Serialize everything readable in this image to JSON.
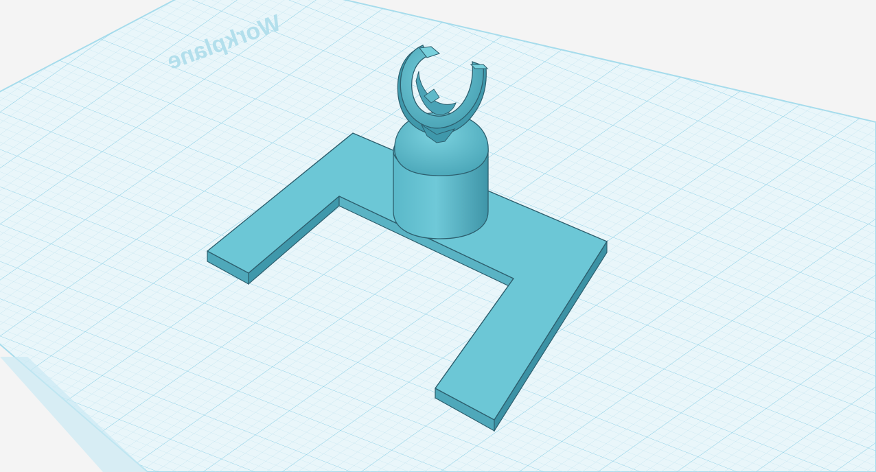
{
  "viewport": {
    "workplane_label": "Workplane"
  },
  "colors": {
    "background": "#f4f4f4",
    "workplane": "#e9f6fa",
    "grid_minor": "#bfe3ef",
    "grid_major": "#7fcbe3",
    "workplane_border": "#a6dcec",
    "model_top": "#6cc7d6",
    "model_front": "#58b4c5",
    "model_side": "#3f98ab",
    "model_edge": "#2d5f6e"
  },
  "icons": {
    "workplane": "grid-plane-icon",
    "model": "3d-object"
  }
}
